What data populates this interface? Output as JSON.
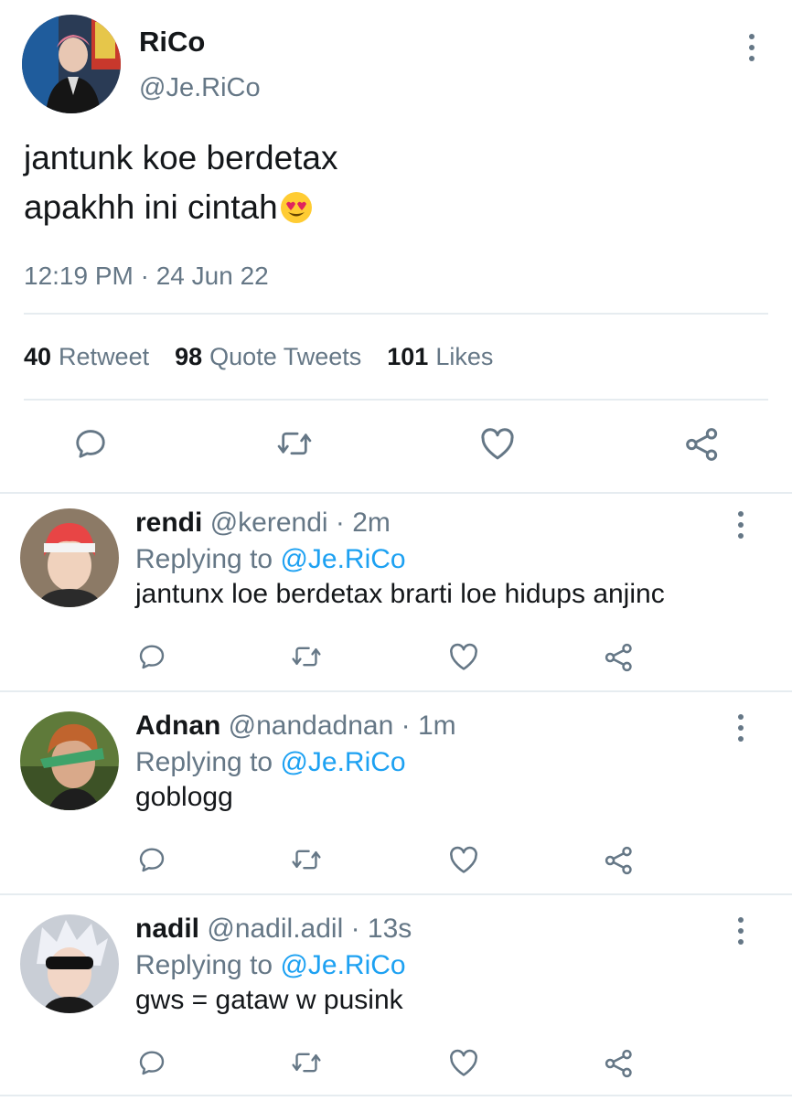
{
  "tweet": {
    "display_name": "RiCo",
    "handle": "@Je.RiCo",
    "text_line1": "jantunk koe berdetax",
    "text_line2": "apakhh ini cintah",
    "emoji": "smiling-face-with-heart-eyes",
    "timestamp": "12:19 PM · 24 Jun 22",
    "stats": {
      "retweets": "40",
      "retweets_label": "Retweet",
      "quotes": "98",
      "quotes_label": "Quote Tweets",
      "likes": "101",
      "likes_label": "Likes"
    }
  },
  "replies": [
    {
      "name": "rendi",
      "handle": "@kerendi",
      "time": "· 2m",
      "replying_prefix": "Replying to",
      "replying_to": "@Je.RiCo",
      "text": "jantunx loe berdetax brarti loe hidups anjinc"
    },
    {
      "name": "Adnan",
      "handle": "@nandadnan",
      "time": "· 1m",
      "replying_prefix": "Replying to",
      "replying_to": "@Je.RiCo",
      "text": "goblogg"
    },
    {
      "name": "nadil",
      "handle": "@nadil.adil",
      "time": "· 13s",
      "replying_prefix": "Replying to",
      "replying_to": "@Je.RiCo",
      "text": "gws = gataw w pusink"
    }
  ],
  "icons": [
    "reply-icon",
    "retweet-icon",
    "like-icon",
    "share-icon",
    "more-icon"
  ],
  "colors": {
    "text": "#14171a",
    "muted": "#657786",
    "link": "#1da1f2",
    "divider": "#e6ecf0"
  }
}
